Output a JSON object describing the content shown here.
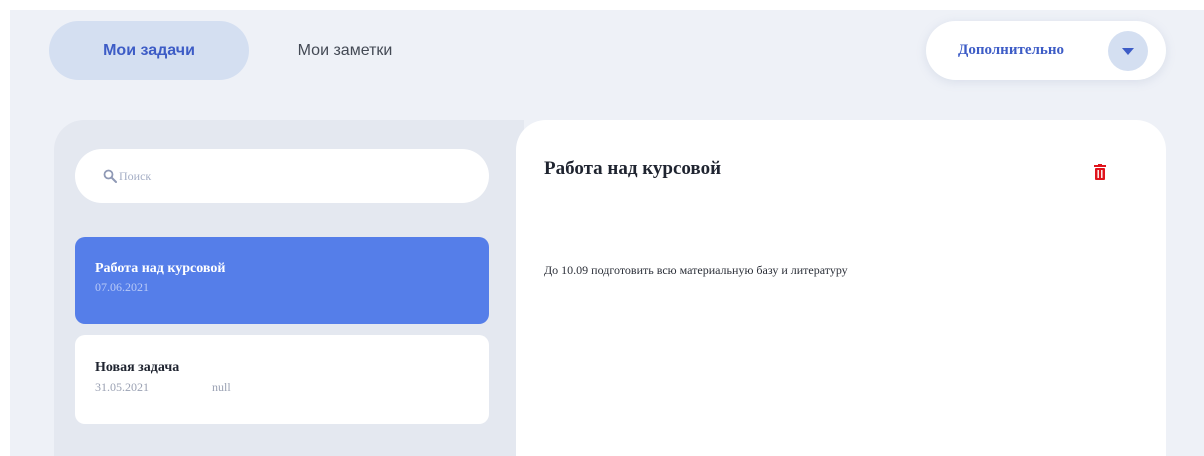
{
  "tabs": [
    {
      "label": "Мои задачи",
      "active": true
    },
    {
      "label": "Мои заметки",
      "active": false
    }
  ],
  "more_menu": {
    "label": "Дополнительно",
    "toggle_icon": "chevron-down-icon"
  },
  "search": {
    "placeholder": "Поиск",
    "icon": "search-icon"
  },
  "tasks": [
    {
      "title": "Работа над курсовой",
      "date": "07.06.2021",
      "extra": "",
      "selected": true
    },
    {
      "title": "Новая задача",
      "date": "31.05.2021",
      "extra": "null",
      "selected": false
    }
  ],
  "detail": {
    "title": "Работа над курсовой",
    "body": "До 10.09 подготовить всю материальную базу и литературу",
    "delete_icon": "trash-icon"
  },
  "colors": {
    "accent": "#3d5cc6",
    "selected_task": "#557ee9",
    "tab_active_bg": "#d4dff1",
    "delete": "#e0141c",
    "background": "#eef1f7"
  }
}
